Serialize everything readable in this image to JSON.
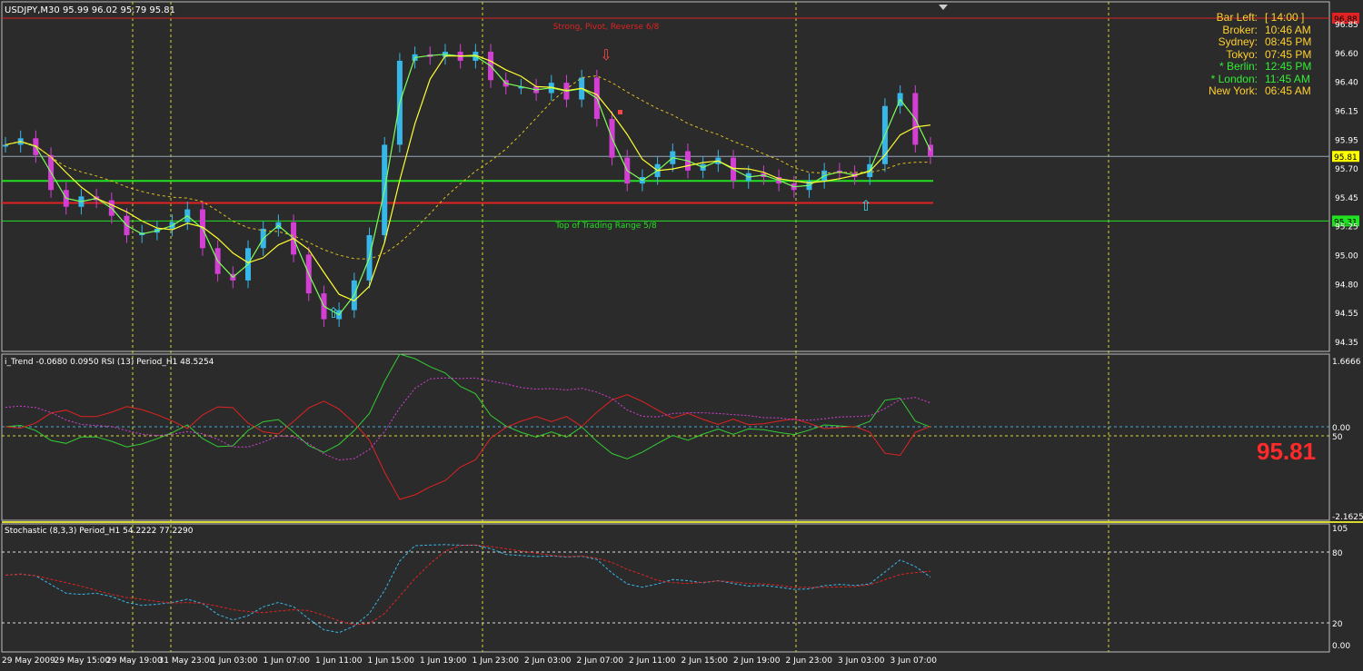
{
  "colors": {
    "background": "#2b2b2b",
    "grid": "#d8d830",
    "bull": "#37b7e8",
    "bear": "#d33fd3",
    "ma_fast": "#7cff5a",
    "ma_slow": "#ffff33",
    "ma_long": "#e0c020",
    "support_green": "#22e022",
    "resist_red": "#e02222",
    "price_line": "#9aa4b8",
    "rsi": "#d33fd3",
    "trend_green": "#33cc33",
    "trend_red": "#e02222",
    "stoch_main": "#37b7e8",
    "stoch_signal": "#e02222",
    "arrow_up": "#33ddee",
    "arrow_down": "#ff4444"
  },
  "main_panel": {
    "header": "USDJPY,M30  95.99 96.02 95.79 95.81",
    "pivot_label": "Strong, Pivot, Reverse  6/8",
    "range_label": "Top of Trading Range  5/8",
    "price_tag": "95.81",
    "level_tag_top": "96.88",
    "level_tag_bottom": "95.31",
    "axis_ticks": [
      "96.85",
      "96.60",
      "96.40",
      "96.15",
      "95.95",
      "95.70",
      "95.45",
      "95.25",
      "95.00",
      "94.80",
      "94.55",
      "94.35"
    ]
  },
  "clock": [
    {
      "label": "Bar Left:",
      "value": "[ 14:00 ]",
      "color": "#ffd030"
    },
    {
      "label": "Broker:",
      "value": "10:46 AM",
      "color": "#ffd030"
    },
    {
      "label": "Sydney:",
      "value": "08:45 PM",
      "color": "#ffd030"
    },
    {
      "label": "Tokyo:",
      "value": "07:45 PM",
      "color": "#ffd030"
    },
    {
      "label": "* Berlin:",
      "value": "12:45 PM",
      "color": "#33ee33"
    },
    {
      "label": "* London:",
      "value": "11:45 AM",
      "color": "#33ee33"
    },
    {
      "label": "New York:",
      "value": "06:45 AM",
      "color": "#ffd030"
    }
  ],
  "indicator1": {
    "header": "i_Trend -0.0680 0.0950  RSI (13) Period_H1 48.5254",
    "ticks": [
      "1.6666",
      "0.00",
      "50",
      "-2.1625"
    ],
    "big_price": "95.81"
  },
  "indicator2": {
    "header": "Stochastic (8,3,3) Period_H1 54.2222 77.2290",
    "ticks": [
      "105",
      "80",
      "20",
      "0.00"
    ]
  },
  "time_axis": [
    "29 May 2009",
    "29 May 15:00",
    "29 May 19:00",
    "31 May 23:00",
    "1 Jun 03:00",
    "1 Jun 07:00",
    "1 Jun 11:00",
    "1 Jun 15:00",
    "1 Jun 19:00",
    "1 Jun 23:00",
    "2 Jun 03:00",
    "2 Jun 07:00",
    "2 Jun 11:00",
    "2 Jun 15:00",
    "2 Jun 19:00",
    "2 Jun 23:00",
    "3 Jun 03:00",
    "3 Jun 07:00"
  ],
  "chart_data": {
    "type": "line",
    "title": "USDJPY,M30",
    "ylim": [
      94.35,
      96.95
    ],
    "levels": [
      96.88,
      95.62,
      95.45,
      95.31,
      95.81
    ],
    "series": [
      {
        "values": [
          95.9,
          95.95,
          95.82,
          95.55,
          95.42,
          95.5,
          95.47,
          95.35,
          95.2,
          95.22,
          95.25,
          95.3,
          95.4,
          95.1,
          94.9,
          94.85,
          95.1,
          95.25,
          95.3,
          95.05,
          94.75,
          94.55,
          94.62,
          94.85,
          95.2,
          95.9,
          96.55,
          96.6,
          96.58,
          96.62,
          96.55,
          96.62,
          96.4,
          96.35,
          96.35,
          96.3,
          96.38,
          96.25,
          96.42,
          96.1,
          95.8,
          95.6,
          95.65,
          95.75,
          95.85,
          95.7,
          95.75,
          95.8,
          95.62,
          95.68,
          95.65,
          95.6,
          95.55,
          95.62,
          95.7,
          95.68,
          95.65,
          95.75,
          96.2,
          96.3,
          95.9,
          95.81
        ]
      }
    ]
  }
}
